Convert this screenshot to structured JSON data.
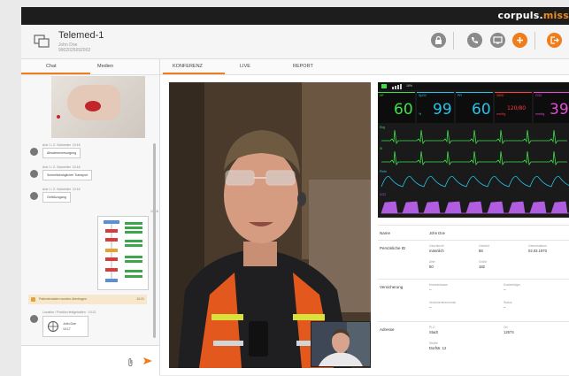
{
  "brand": {
    "name_main": "corpuls.",
    "name_accent": "miss"
  },
  "header": {
    "title": "Telemed-1",
    "subtitle_name": "John Doe",
    "subtitle_id": "9902025092002"
  },
  "left_tabs": [
    {
      "label": "Chat"
    },
    {
      "label": "Medien"
    }
  ],
  "chat": {
    "messages": [
      {
        "sender": "Arzt 1 / Z. Schneider",
        "time": "10:16",
        "text": "Abwärmeversorgung"
      },
      {
        "sender": "Arzt 1 / Z. Schneider",
        "time": "10:16",
        "text": "Schnellstmöglicher Transport"
      },
      {
        "sender": "Arzt 1 / Z. Schneider",
        "time": "10:16",
        "text": "Gefäßzugang"
      }
    ],
    "document_time": "10:18",
    "warning": {
      "text": "Patientendaten wurden übertragen",
      "time": "10:21"
    },
    "location": {
      "meta": "Location / Position festgehalten · 10:21",
      "name": "John Doe",
      "time": "10:17"
    }
  },
  "main_tabs": [
    {
      "label": "KONFERENZ"
    },
    {
      "label": "LIVE"
    },
    {
      "label": "REPORT"
    }
  ],
  "monitor": {
    "status": "16%",
    "tiles": [
      {
        "label": "HF",
        "value": "60",
        "unit": "",
        "color": "#3ee04a"
      },
      {
        "label": "SpO2",
        "value": "99",
        "unit": "%",
        "color": "#27c3e8"
      },
      {
        "label": "PR",
        "value": "60",
        "unit": "",
        "color": "#27c3e8"
      },
      {
        "label": "NIBD",
        "value": "120/80",
        "unit": "mmHg",
        "color": "#ff3b3b"
      },
      {
        "label": "CO2",
        "value": "39",
        "unit": "mmHg",
        "color": "#e84ad6"
      }
    ],
    "waves": [
      {
        "label": "Ekg",
        "color": "#3ee04a"
      },
      {
        "label": "III",
        "color": "#3ee04a"
      },
      {
        "label": "Pleth",
        "color": "#27c3e8"
      },
      {
        "label": "CO2",
        "color": "#b05de0"
      }
    ]
  },
  "patient": {
    "name_label": "Name",
    "name_value": "John Doe",
    "personal_label": "Persönliche ID",
    "sex_label": "Geschlecht",
    "sex_value": "männlich",
    "weight_label": "Gewicht",
    "weight_value": "88",
    "birth_label": "Geburtsdatum",
    "birth_value": "02.03.1970",
    "age_label": "Alter",
    "age_value": "50",
    "height_label": "Größe",
    "height_value": "182",
    "insurance_label": "Versicherung",
    "ins_company_label": "Krankenkasse",
    "ins_company_value": "--",
    "ins_number_label": "Kostenträger",
    "ins_number_value": "--",
    "ins_member_label": "Versichertennummer",
    "ins_member_value": "--",
    "ins_status_label": "Status",
    "ins_status_value": "--",
    "address_label": "Adresse",
    "city_label": "PLZ",
    "city_value": "Stadt",
    "zip_label": "Ort",
    "zip_value": "12574",
    "street_label": "Straße",
    "street_value": "Dorfstr. 12"
  }
}
